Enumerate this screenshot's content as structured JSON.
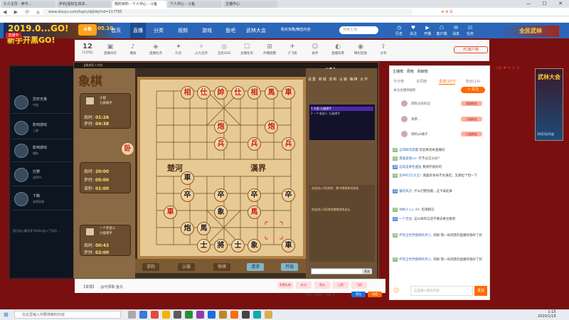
{
  "browser": {
    "tabs": [
      "3.小主页 - 参与...",
      "炉石|鼠标左双杀..",
      "我的资料 - 个人中心 - 斗鱼",
      "个人中心 - 斗鱼",
      "主播中心"
    ],
    "url": "www.douyu.com/topic/djjtdq?rid=217785"
  },
  "overlay": {
    "line1": "2019.0...GO!",
    "line2": "新手开黑GO!",
    "line1b": "2019.05.10",
    "badge": "直播中"
  },
  "site": {
    "logo": "斗鱼",
    "nav": [
      "首页",
      "直播",
      "分类",
      "视频",
      "游戏",
      "鱼吧",
      "武林大会"
    ],
    "nav_active": "直播",
    "promo": "购买攻略/精选内容",
    "search_placeholder": "搜索主播",
    "header_icons": [
      {
        "icon": "history-icon",
        "label": "历史"
      },
      {
        "icon": "follow-icon",
        "label": "关注"
      },
      {
        "icon": "live-icon",
        "label": "开播"
      },
      {
        "icon": "user-icon",
        "label": "客户端"
      },
      {
        "icon": "mail-icon",
        "label": "消息"
      },
      {
        "icon": "task-icon",
        "label": "任务"
      },
      {
        "icon": "coin-icon",
        "label": "鱼丸"
      }
    ],
    "corner_brand": "全民武林"
  },
  "toolbar": {
    "date_day": "12",
    "date_sub": "12月9日",
    "items": [
      "直播日历",
      "播放",
      "直播任务",
      "礼包",
      "火力全开",
      "全民SOS",
      "主播任务",
      "开播提醒",
      "小飞船",
      "助手",
      "直播背景",
      "精彩回放",
      "分享"
    ],
    "pc_button": "PC客户端"
  },
  "lol_panel": {
    "rows": [
      {
        "name": "异形无畏",
        "sub": "中路"
      },
      {
        "name": "影响游戏",
        "sub": "上路"
      },
      {
        "name": "影响游戏",
        "sub": "辅助"
      },
      {
        "name": "打野",
        "sub": "选择中..."
      },
      {
        "name": "下路",
        "sub": "选择英雄"
      }
    ],
    "chat": "您已加入聊天室 feitian加入了队伍 ..."
  },
  "chess": {
    "title_text": "JJ象棋双人对弈",
    "logo": "象棋",
    "top_player": {
      "name": "大胆",
      "title": "九级棋手",
      "step_label": "局时",
      "step": "01:26",
      "move_label": "步时",
      "move": "04:38"
    },
    "mid_timer": {
      "label1": "局时",
      "v1": "20:00",
      "label2": "步时",
      "v2": "05:00",
      "label3": "读秒",
      "v3": "01:00"
    },
    "bottom_player": {
      "name": "一个老鼠人",
      "title": "九级棋手",
      "step_label": "局时",
      "step": "00:43",
      "move_label": "步时",
      "move": "02:00"
    },
    "river_left": "楚河",
    "river_right": "漢界",
    "side_icons": [
      "设置",
      "商城",
      "求和",
      "认输",
      "悔棋",
      "大字"
    ],
    "moves": [
      {
        "n": "1",
        "name": "大胆",
        "t": "九级棋手"
      },
      {
        "n": "2",
        "name": "一个老鼠人",
        "t": "九级棋手"
      }
    ],
    "chat_lines": [
      "欢迎进入QQ游戏：象中围棋休闲游戏",
      "欢迎进入QQ游戏棋牌游戏论坛"
    ],
    "bottom_buttons": [
      "求和",
      "认输",
      "悔棋",
      "请求",
      "开局"
    ],
    "send": "发送"
  },
  "streambar": {
    "report": "【举报】    @可领取 鱼丸",
    "gifts": [
      "免费礼物",
      "办卡",
      "鱼丸",
      "火箭",
      "飞机"
    ],
    "balance": "鱼丸: 14884   鱼翅: 0",
    "recharge": "充值",
    "buy": "背包"
  },
  "right_panel": {
    "header": "主播榜   周榜   贡献榜",
    "tabs": [
      "今日榜",
      "本周榜",
      "贵宾(107)",
      "粉丝(14)"
    ],
    "tab_active": "贵宾(107)",
    "notice": "关注主播领福利",
    "follow": "+ 关注",
    "fans": [
      {
        "name": "风吹过去的记",
        "badge": "超级粉丝"
      },
      {
        "name": "清茶...",
        "badge": "九级粉丝"
      },
      {
        "name": "雨轩pk橘子",
        "badge": "九级粉丝"
      }
    ],
    "chats": [
      {
        "lv": "22",
        "name": "五四鲜花提醒",
        "text": "欢迎来到本直播间"
      },
      {
        "lv": "21",
        "name": "遇喜爱看ssr:",
        "text": "打不过怎么办？"
      },
      {
        "lv": "18",
        "name": "这就是黄色面鱼",
        "text": "我保存很好的"
      },
      {
        "lv": "12",
        "name": "追中的刀(大王):",
        "text": "我喜欢本局不太满足。又想拉个挡一下"
      },
      {
        "lv": "13",
        "name": "懂花风云:",
        "text": "什么打野思路，这卡拿起来"
      },
      {
        "lv": "17",
        "name": "帅帅人 Lv. 4X:",
        "text": "吃喝棋马"
      },
      {
        "lv": "15",
        "name": "一个老鼠:",
        "text": "这么样的马还不要去象台象新"
      },
      {
        "lv": "16",
        "name": "坏的全世界都拥有月儿:",
        "text": "风眼 我一局到底的直播有钱好了好"
      },
      {
        "lv": "17",
        "name": "坏的全世界都拥有月儿:",
        "text": "风眼 我一局到底的直播有钱好了好"
      }
    ],
    "input_placeholder": "这里输入聊天内容",
    "send": "发送"
  },
  "side": {
    "icons": "斗鱼 ♥ ⚙ ★ ☰",
    "ad_text": "武林大会",
    "ad_sub": "10月3日开战"
  },
  "taskbar": {
    "search_placeholder": "在这里输入你要搜索的内容",
    "time": "1:15",
    "date": "2020/1/16"
  }
}
